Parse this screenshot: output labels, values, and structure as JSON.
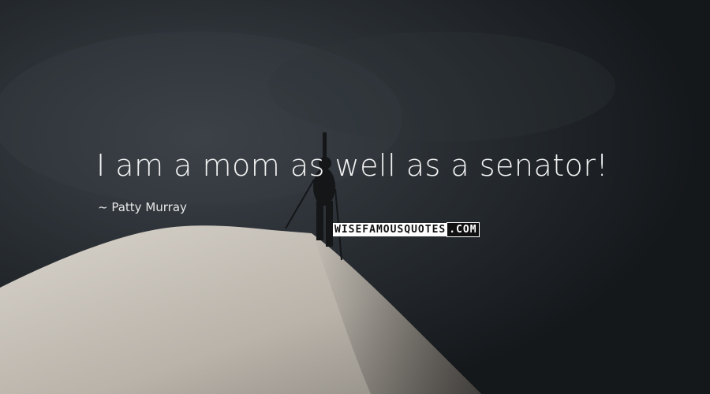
{
  "quote": {
    "text": "I am a mom as well as a senator!",
    "author": "Patty Murray"
  },
  "watermark": {
    "part1": "WISEFAMOUSQUOTES",
    "part2": ".COM"
  },
  "colors": {
    "sky": "#1c2024",
    "snow": "#c9c4bc",
    "text": "#f2f2f2"
  }
}
